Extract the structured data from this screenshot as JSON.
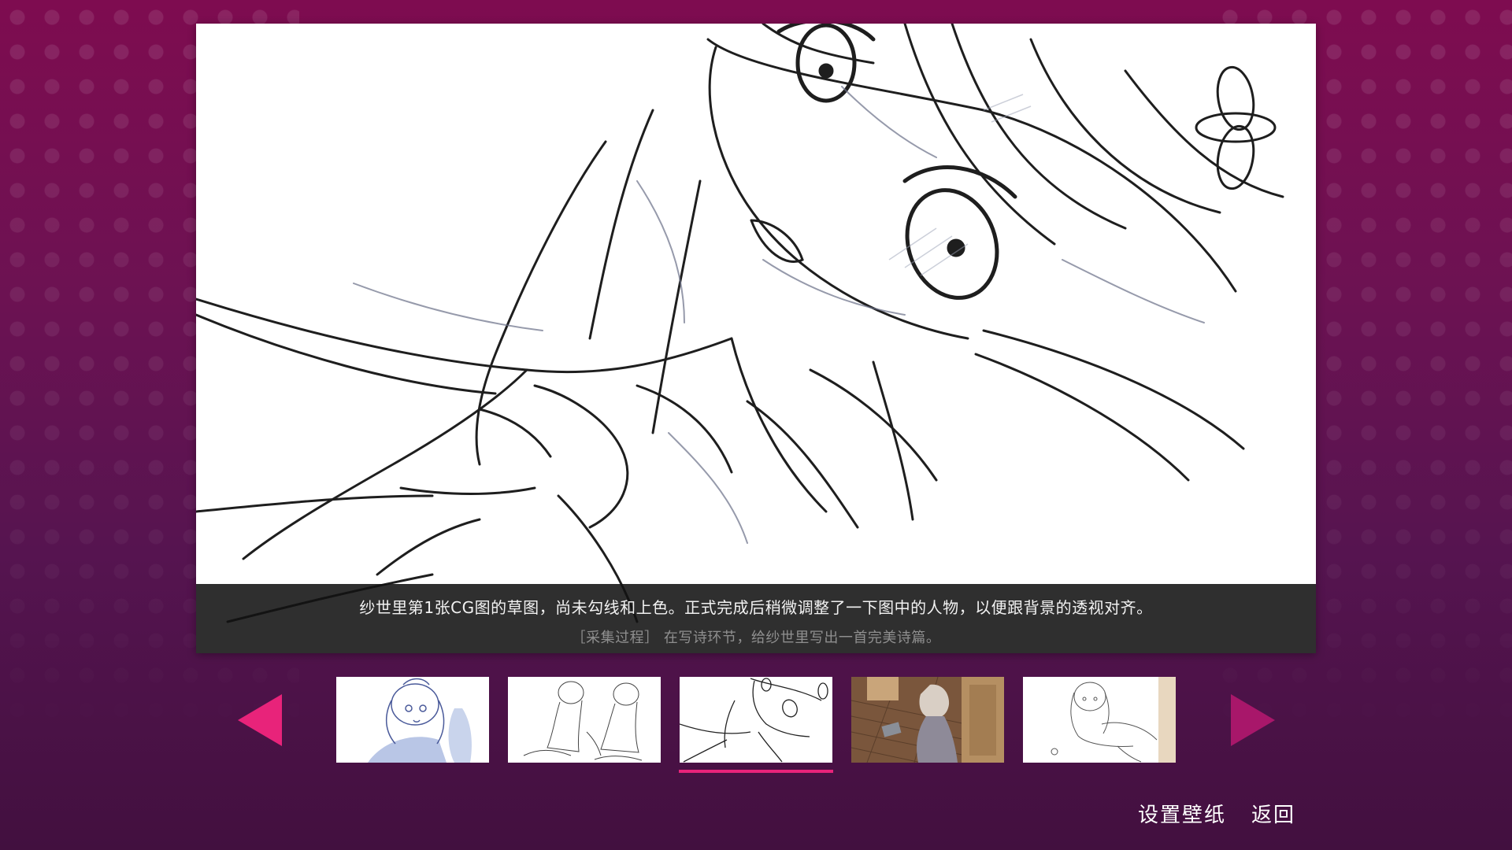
{
  "viewer": {
    "description": "纱世里第1张CG图的草图，尚未勾线和上色。正式完成后稍微调整了一下图中的人物，以便跟背景的透视对齐。",
    "unlock_hint": "［采集过程］ 在写诗环节，给纱世里写出一首完美诗篇。"
  },
  "gallery": {
    "selected_index": 2,
    "thumbnails": [
      {
        "name": "thumbnail-1",
        "style": "blue-sketch"
      },
      {
        "name": "thumbnail-2",
        "style": "pencil-sketch"
      },
      {
        "name": "thumbnail-3",
        "style": "pencil-sketch"
      },
      {
        "name": "thumbnail-4",
        "style": "color-render"
      },
      {
        "name": "thumbnail-5",
        "style": "pencil-sketch"
      }
    ],
    "prev_icon": "triangle-left-icon",
    "next_icon": "triangle-right-icon"
  },
  "menu": {
    "set_wallpaper": "设置壁纸",
    "back": "返回"
  },
  "colors": {
    "accent": "#e8237a",
    "arrow_prev": "#e8237a",
    "arrow_next": "#a8176a",
    "caption_bg": "#121212"
  }
}
